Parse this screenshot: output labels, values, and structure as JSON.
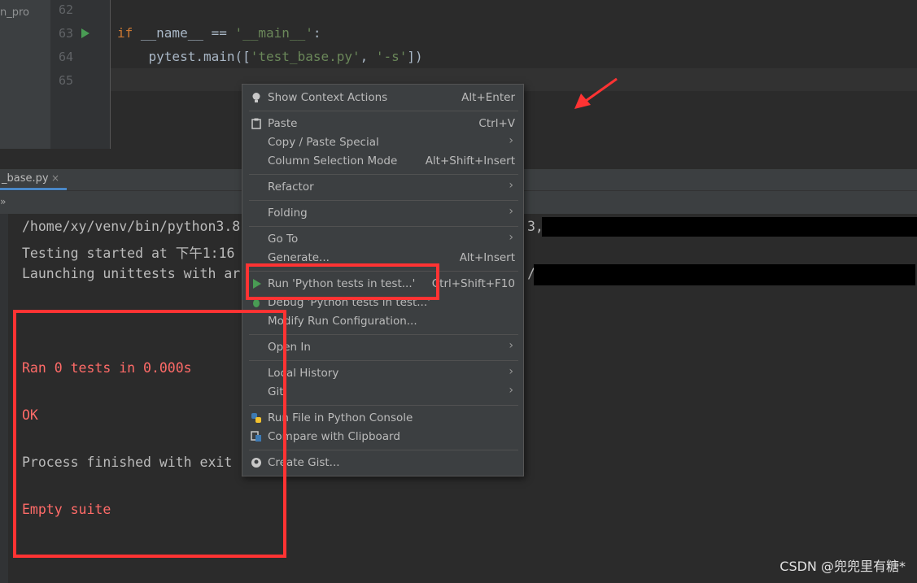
{
  "project": {
    "label": "n_pro"
  },
  "editor": {
    "line_numbers": [
      "62",
      "63",
      "64",
      "65"
    ],
    "line63": {
      "kw": "if",
      "mid": " __name__ == ",
      "str": "'__main__'",
      "end": ":"
    },
    "line64": {
      "pre": "    pytest.main([",
      "s1": "'test_base.py'",
      "comma": ", ",
      "s2": "'-s'",
      "end": "])"
    }
  },
  "tool_window": {
    "tab_label": "_base.py",
    "tab_close": "×",
    "toolbar_icon": "»"
  },
  "console": {
    "lines": [
      "/home/xy/venv/bin/python3.8",
      "Testing started at 下午1:16",
      "Launching unittests with ar",
      "Ran 0 tests in 0.000s",
      "OK",
      "Process finished with exit",
      "Empty suite"
    ],
    "fragment_1": "3,",
    "fragment_2": "/"
  },
  "context_menu": {
    "items": [
      {
        "label": "Show Context Actions",
        "shortcut": "Alt+Enter",
        "icon": "bulb-icon"
      },
      {
        "label": "Paste",
        "shortcut": "Ctrl+V",
        "icon": "clipboard-icon"
      },
      {
        "label": "Copy / Paste Special",
        "arrow": "›"
      },
      {
        "label": "Column Selection Mode",
        "shortcut": "Alt+Shift+Insert"
      },
      {
        "label": "Refactor",
        "arrow": "›"
      },
      {
        "label": "Folding",
        "arrow": "›"
      },
      {
        "label": "Go To",
        "arrow": "›"
      },
      {
        "label": "Generate...",
        "shortcut": "Alt+Insert"
      },
      {
        "label": "Run 'Python tests in test...'",
        "shortcut": "Ctrl+Shift+F10",
        "icon": "run-icon"
      },
      {
        "label": "Debug 'Python tests in test...'",
        "icon": "debug-icon"
      },
      {
        "label": "Modify Run Configuration..."
      },
      {
        "label": "Open In",
        "arrow": "›"
      },
      {
        "label": "Local History",
        "arrow": "›"
      },
      {
        "label": "Git",
        "arrow": "›"
      },
      {
        "label": "Run File in Python Console",
        "icon": "python-icon"
      },
      {
        "label": "Compare with Clipboard",
        "icon": "compare-icon"
      },
      {
        "label": "Create Gist...",
        "icon": "github-icon"
      }
    ]
  },
  "colors": {
    "annotation_red": "#ff3333",
    "run_green": "#499c54",
    "string_green": "#6a8759",
    "keyword_orange": "#cc7832"
  },
  "watermark": "CSDN @兜兜里有糖*"
}
